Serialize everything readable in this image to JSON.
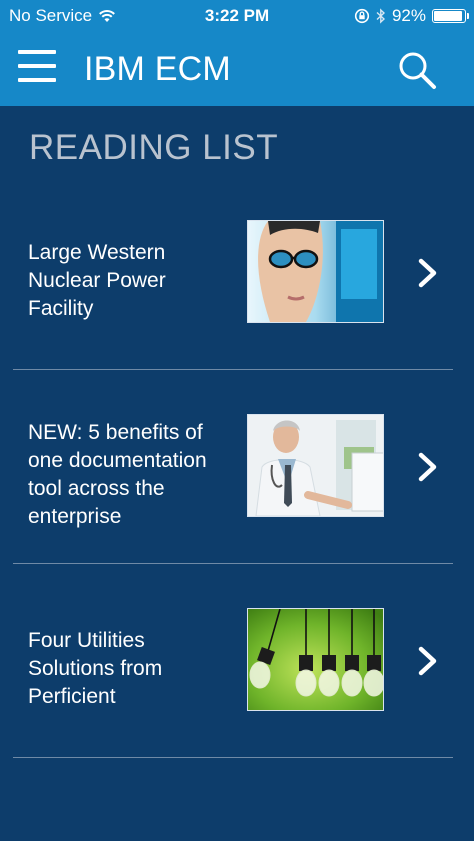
{
  "status_bar": {
    "carrier": "No Service",
    "time": "3:22 PM",
    "battery": "92%",
    "battery_level": 0.92
  },
  "header": {
    "title": "IBM ECM",
    "menu_icon": "hamburger-menu-icon",
    "search_icon": "search-icon"
  },
  "section": {
    "title": "READING LIST"
  },
  "items": [
    {
      "title": "Large Western Nuclear Power Facility",
      "image": "woman-with-glasses-at-monitor"
    },
    {
      "title": "NEW: 5 benefits of one documentation tool across the enterprise",
      "image": "doctor-at-computer"
    },
    {
      "title": "Four Utilities Solutions from Perficient",
      "image": "hanging-light-bulbs-green"
    }
  ],
  "colors": {
    "header": "#1688c8",
    "background": "#0d3d6b",
    "section_title": "#b9c3cf",
    "divider": "#6f8aa6"
  }
}
